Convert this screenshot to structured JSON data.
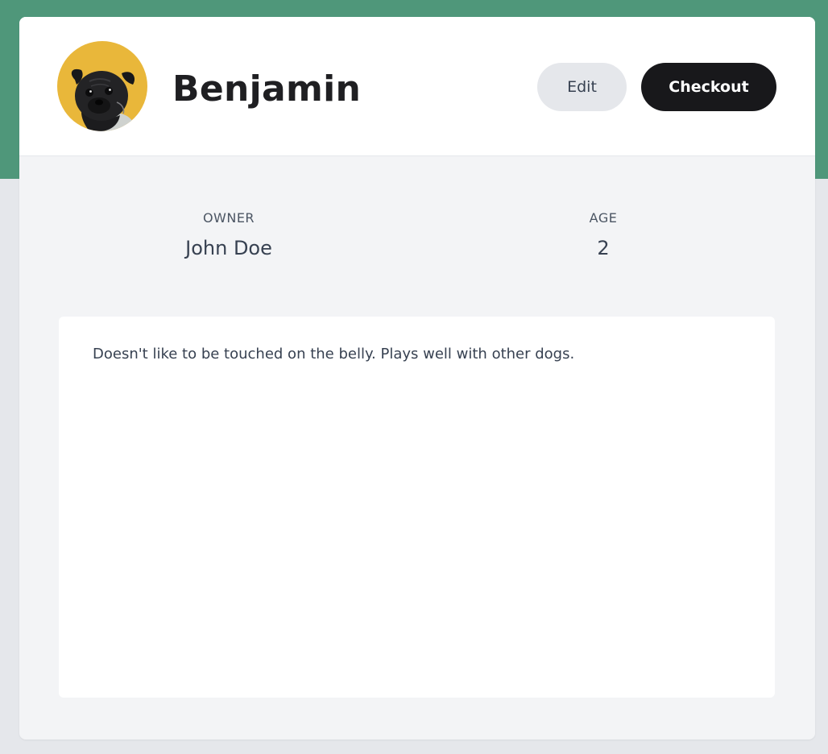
{
  "pet": {
    "name": "Benjamin",
    "avatar_icon": "pug-avatar",
    "avatar_bg": "#e9b73a"
  },
  "actions": {
    "edit_label": "Edit",
    "checkout_label": "Checkout"
  },
  "details": {
    "owner_label": "OWNER",
    "owner_value": "John Doe",
    "age_label": "AGE",
    "age_value": "2"
  },
  "notes": {
    "text": "Doesn't like to be touched on the belly. Plays well with other dogs."
  },
  "colors": {
    "accent_band": "#4f977a",
    "primary_button": "#18181b",
    "secondary_button": "#e5e7eb"
  }
}
